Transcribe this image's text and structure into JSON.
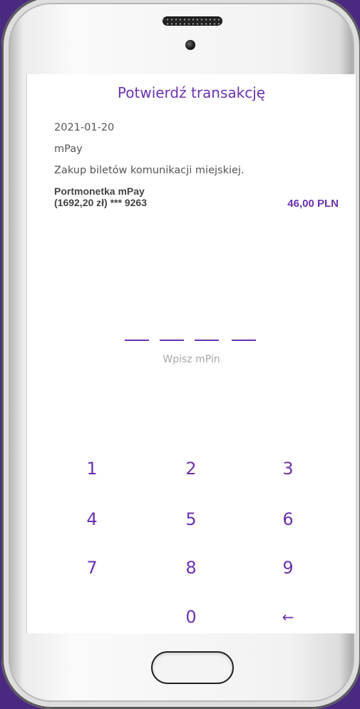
{
  "screen": {
    "title": "Potwierdź transakcję",
    "date": "2021-01-20",
    "merchant": "mPay",
    "description": "Zakup biletów komunikacji miejskiej.",
    "source_name": "Portmonetka mPay",
    "source_detail": "(1692,20 zł) *** 9263",
    "amount": "46,00 PLN",
    "pin_hint": "Wpisz mPin"
  },
  "keypad": {
    "k1": "1",
    "k2": "2",
    "k3": "3",
    "k4": "4",
    "k5": "5",
    "k6": "6",
    "k7": "7",
    "k8": "8",
    "k9": "9",
    "k0": "0",
    "backspace": "←"
  },
  "colors": {
    "accent": "#6b32b0",
    "background": "#4a2a80"
  }
}
